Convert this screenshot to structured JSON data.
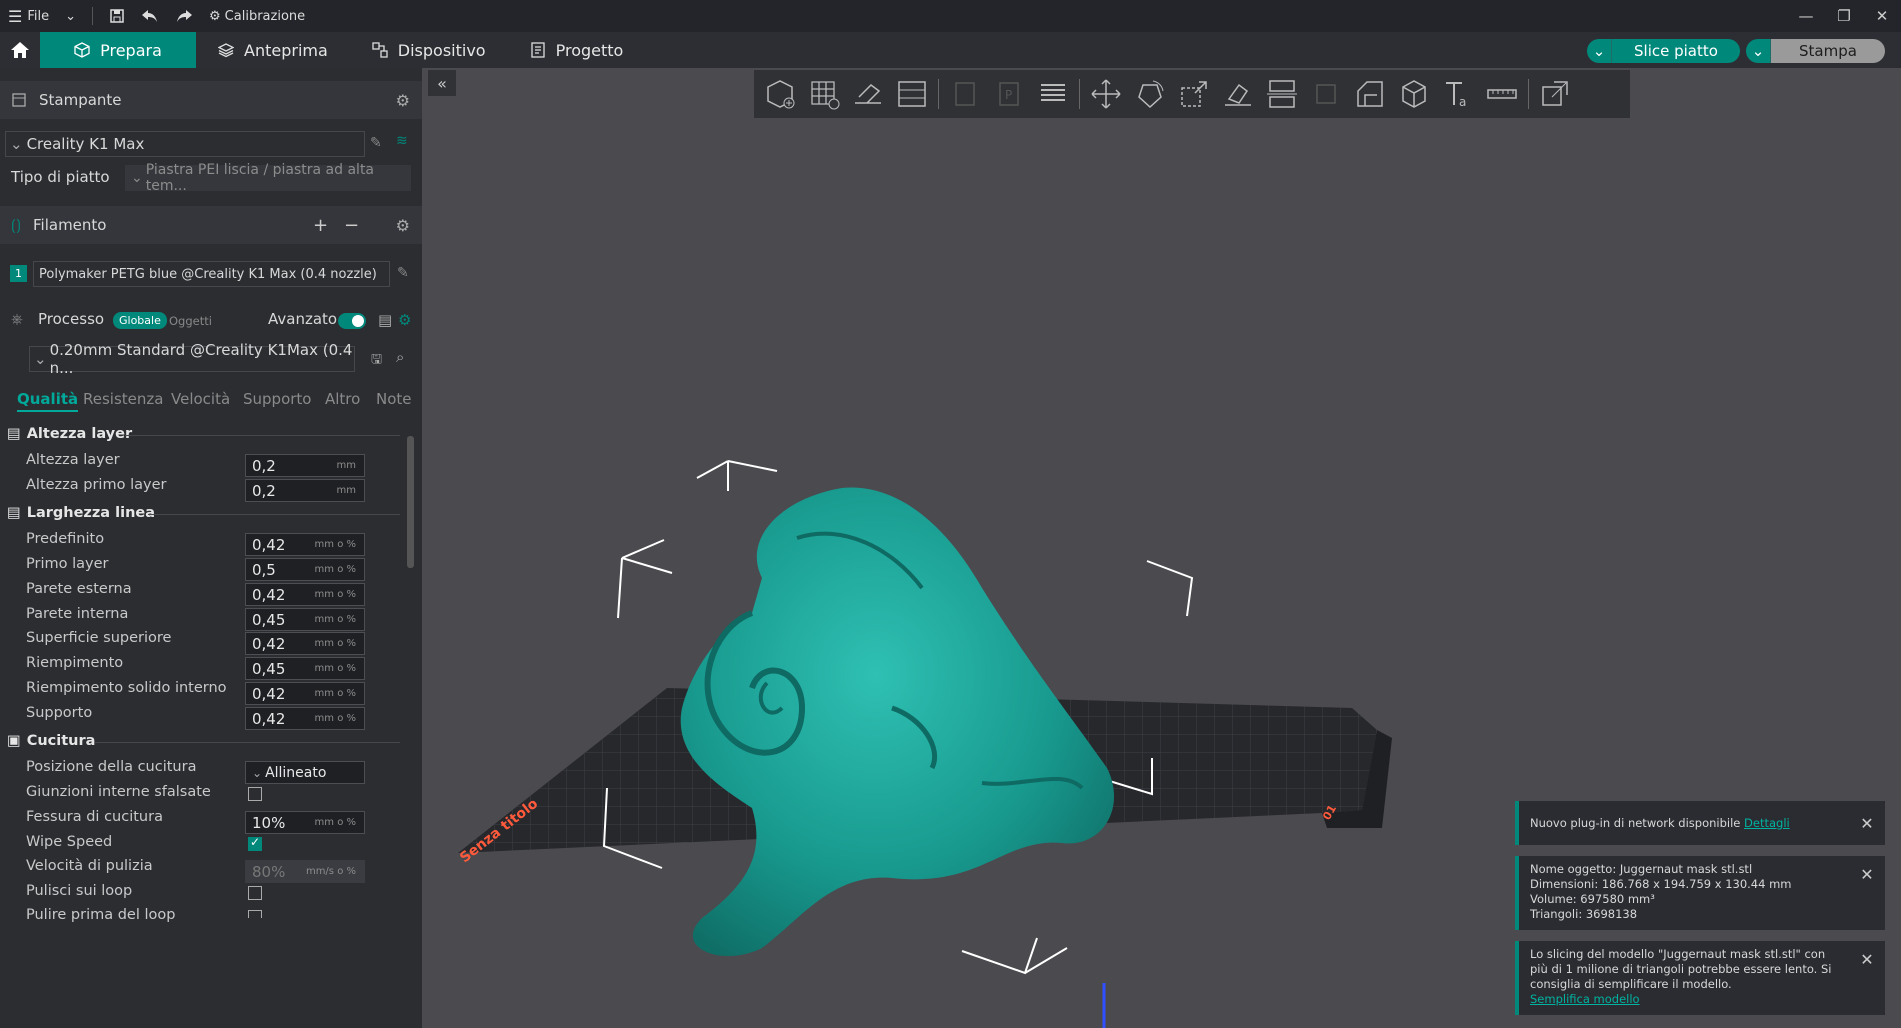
{
  "topbar": {
    "file": "File",
    "calibration": "Calibrazione"
  },
  "nav": {
    "tabs": [
      "Prepara",
      "Anteprima",
      "Dispositivo",
      "Progetto"
    ],
    "slice_label": "Slice piatto",
    "print_label": "Stampa"
  },
  "printer": {
    "section_title": "Stampante",
    "name": "Creality K1 Max",
    "plate_label": "Tipo di piatto",
    "plate_value": "Piastra PEI liscia / piastra ad alta tem..."
  },
  "filament": {
    "section_title": "Filamento",
    "slot": "1",
    "name": "Polymaker PETG blue @Creality K1 Max (0.4 nozzle)"
  },
  "process": {
    "section_title": "Processo",
    "global": "Globale",
    "objects": "Oggetti",
    "advanced": "Avanzato",
    "advanced_on": true,
    "profile": "0.20mm Standard @Creality K1Max (0.4 n..."
  },
  "subtabs": [
    "Qualità",
    "Resistenza",
    "Velocità",
    "Supporto",
    "Altro",
    "Note"
  ],
  "groups": {
    "layer_height": "Altezza layer",
    "line_width": "Larghezza linea",
    "seam": "Cucitura"
  },
  "params": {
    "layer_height": {
      "label": "Altezza layer",
      "value": "0,2",
      "unit": "mm"
    },
    "first_layer_height": {
      "label": "Altezza primo layer",
      "value": "0,2",
      "unit": "mm"
    },
    "default": {
      "label": "Predefinito",
      "value": "0,42",
      "unit": "mm o %"
    },
    "first_layer": {
      "label": "Primo layer",
      "value": "0,5",
      "unit": "mm o %"
    },
    "outer_wall": {
      "label": "Parete esterna",
      "value": "0,42",
      "unit": "mm o %"
    },
    "inner_wall": {
      "label": "Parete interna",
      "value": "0,45",
      "unit": "mm o %"
    },
    "top_surface": {
      "label": "Superficie superiore",
      "value": "0,42",
      "unit": "mm o %"
    },
    "infill": {
      "label": "Riempimento",
      "value": "0,45",
      "unit": "mm o %"
    },
    "internal_solid_infill": {
      "label": "Riempimento solido interno",
      "value": "0,42",
      "unit": "mm o %"
    },
    "support": {
      "label": "Supporto",
      "value": "0,42",
      "unit": "mm o %"
    },
    "seam_position": {
      "label": "Posizione della cucitura",
      "value": "Allineato"
    },
    "staggered_inner_seams": {
      "label": "Giunzioni interne sfalsate",
      "checked": false
    },
    "seam_gap": {
      "label": "Fessura di cucitura",
      "value": "10%",
      "unit": "mm o %"
    },
    "wipe_speed_toggle": {
      "label": "Wipe Speed",
      "checked": true
    },
    "wipe_speed": {
      "label": "Velocità di pulizia",
      "value": "80%",
      "unit": "mm/s o %"
    },
    "wipe_on_loops": {
      "label": "Pulisci sui loop",
      "checked": false
    },
    "wipe_before_loop": {
      "label": "Pulire prima del loop",
      "checked": false
    }
  },
  "viewport": {
    "plate_name": "Senza titolo",
    "plate_number": "01"
  },
  "notifications": [
    {
      "text": "Nuovo plug-in di network disponibile",
      "link": "Dettagli"
    },
    {
      "lines": [
        "Nome oggetto: Juggernaut mask stl.stl",
        "Dimensioni: 186.768 x 194.759 x 130.44 mm",
        "Volume: 697580 mm³",
        "Triangoli: 3698138"
      ]
    },
    {
      "text": "Lo slicing del modello \"Juggernaut mask stl.stl\" con più di 1 milione di triangoli potrebbe essere lento. Si consiglia di semplificare il modello.",
      "link": "Semplifica modello"
    }
  ],
  "colors": {
    "accent": "#00897b",
    "model": "#1aa39a",
    "bg": "#4a4a4f",
    "panel": "#2b2d31"
  }
}
